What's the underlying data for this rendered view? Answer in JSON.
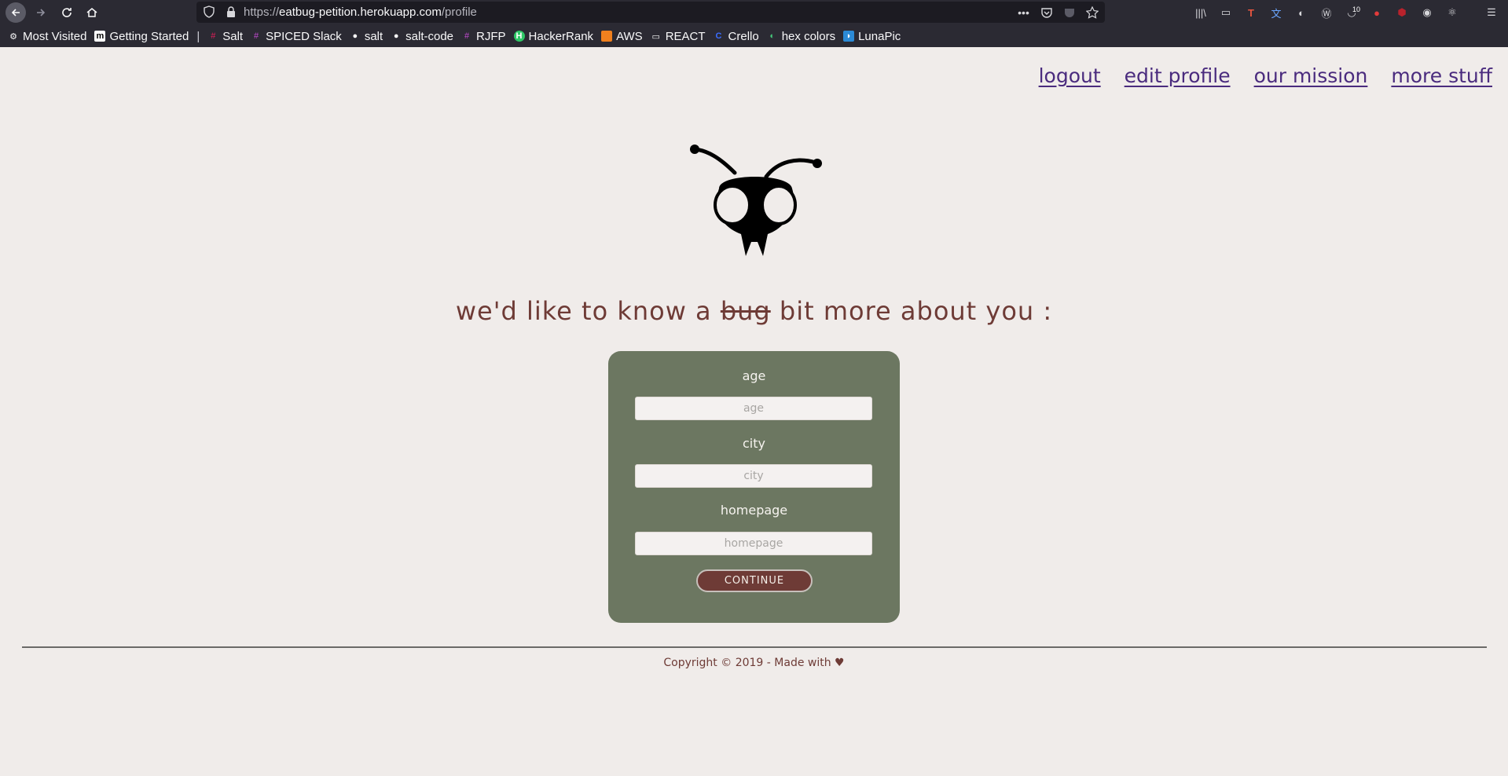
{
  "browser": {
    "url": {
      "protocol": "https://",
      "host": "eatbug-petition.herokuapp.com",
      "path": "/profile"
    },
    "extension_badge": "10",
    "bookmarks": [
      {
        "label": "Most Visited",
        "icon": "gear-icon"
      },
      {
        "label": "Getting Started",
        "icon": "m-icon"
      },
      {
        "label": "Salt",
        "icon": "slack-icon"
      },
      {
        "label": "SPICED Slack",
        "icon": "slack-icon"
      },
      {
        "label": "salt",
        "icon": "github-icon"
      },
      {
        "label": "salt-code",
        "icon": "github-icon"
      },
      {
        "label": "RJFP",
        "icon": "slack-icon"
      },
      {
        "label": "HackerRank",
        "icon": "hackerrank-icon"
      },
      {
        "label": "AWS",
        "icon": "aws-icon"
      },
      {
        "label": "REACT",
        "icon": "folder-icon"
      },
      {
        "label": "Crello",
        "icon": "crello-icon"
      },
      {
        "label": "hex colors",
        "icon": "color-wheel-icon"
      },
      {
        "label": "LunaPic",
        "icon": "lunapic-icon"
      }
    ]
  },
  "nav": {
    "logout": "logout",
    "edit_profile": "edit profile",
    "our_mission": "our mission",
    "more_stuff": "more stuff"
  },
  "headline": {
    "before": "we'd like to know a",
    "struck": "bug",
    "after": "bit more about you :"
  },
  "form": {
    "age_label": "age",
    "age_placeholder": "age",
    "city_label": "city",
    "city_placeholder": "city",
    "homepage_label": "homepage",
    "homepage_placeholder": "homepage",
    "continue_label": "CONTINUE"
  },
  "footer": {
    "text": "Copyright © 2019 - Made with",
    "heart": "♥"
  },
  "colors": {
    "page_bg": "#f0ecea",
    "accent_brown": "#6e3b36",
    "card_green": "#6c7761",
    "link_purple": "#4a2b7e"
  }
}
